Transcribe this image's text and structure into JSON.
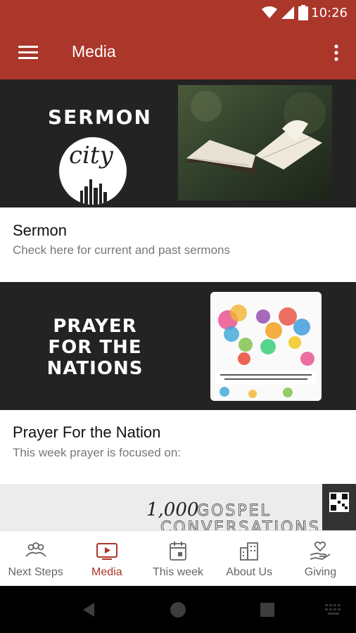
{
  "status_bar": {
    "time": "10:26"
  },
  "app_bar": {
    "title": "Media",
    "menu_icon": "hamburger-menu-icon",
    "overflow_icon": "more-vert-icon"
  },
  "colors": {
    "primary": "#ab362a",
    "banner_bg": "#232323",
    "subtitle": "#777777"
  },
  "media_items": [
    {
      "banner_heading": "SERMON",
      "banner_script": "city",
      "title": "Sermon",
      "subtitle": "Check here for current and past sermons"
    },
    {
      "banner_lines": [
        "PRAYER",
        "FOR THE",
        "NATIONS"
      ],
      "title": "Prayer For the Nation",
      "subtitle": "This week prayer is focused on:"
    },
    {
      "banner_number": "1,000",
      "banner_word1": "GOSPEL",
      "banner_word2": "CONVERSATIONS"
    }
  ],
  "bottom_nav": [
    {
      "label": "Next Steps",
      "icon": "people-group-icon",
      "active": false
    },
    {
      "label": "Media",
      "icon": "tv-play-icon",
      "active": true
    },
    {
      "label": "This week",
      "icon": "calendar-icon",
      "active": false
    },
    {
      "label": "About Us",
      "icon": "buildings-icon",
      "active": false
    },
    {
      "label": "Giving",
      "icon": "heart-hand-icon",
      "active": false
    }
  ],
  "system_nav": {
    "back_icon": "back-triangle-icon",
    "home_icon": "home-circle-icon",
    "recents_icon": "recents-square-icon",
    "keyboard_icon": "keyboard-icon"
  }
}
